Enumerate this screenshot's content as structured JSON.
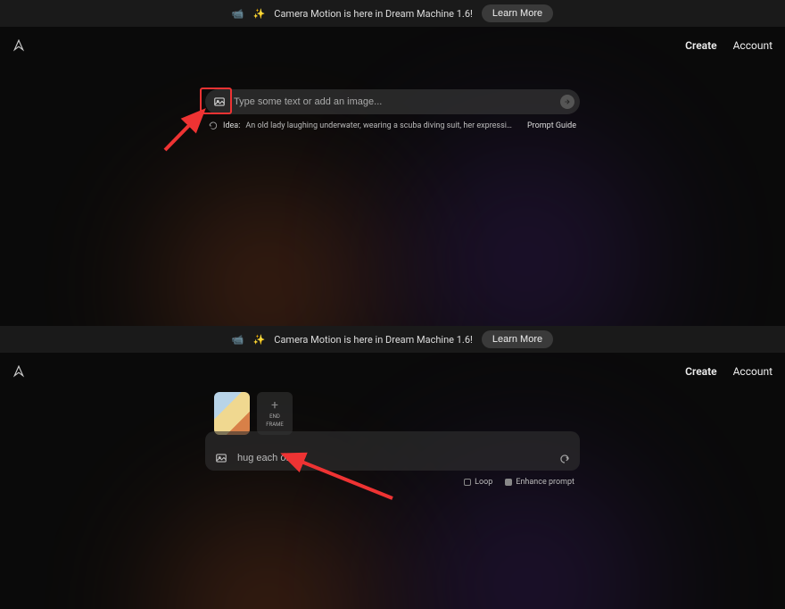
{
  "top": {
    "banner": {
      "emoji1": "📹",
      "emoji2": "✨",
      "text": "Camera Motion is here in Dream Machine 1.6!",
      "learn": "Learn More"
    },
    "nav": {
      "create": "Create",
      "account": "Account"
    },
    "prompt": {
      "placeholder": "Type some text or add an image...",
      "idea_label": "Idea:",
      "idea_text": "An old lady laughing underwater, wearing a scuba diving suit, her expression denotes calm and happiness",
      "prompt_guide": "Prompt Guide"
    }
  },
  "bottom": {
    "banner": {
      "emoji1": "📹",
      "emoji2": "✨",
      "text": "Camera Motion is here in Dream Machine 1.6!",
      "learn": "Learn More"
    },
    "nav": {
      "create": "Create",
      "account": "Account"
    },
    "frames": {
      "end_label_line1": "END",
      "end_label_line2": "FRAME"
    },
    "prompt": {
      "text": "hug each other"
    },
    "options": {
      "loop": "Loop",
      "enhance": "Enhance prompt"
    }
  }
}
